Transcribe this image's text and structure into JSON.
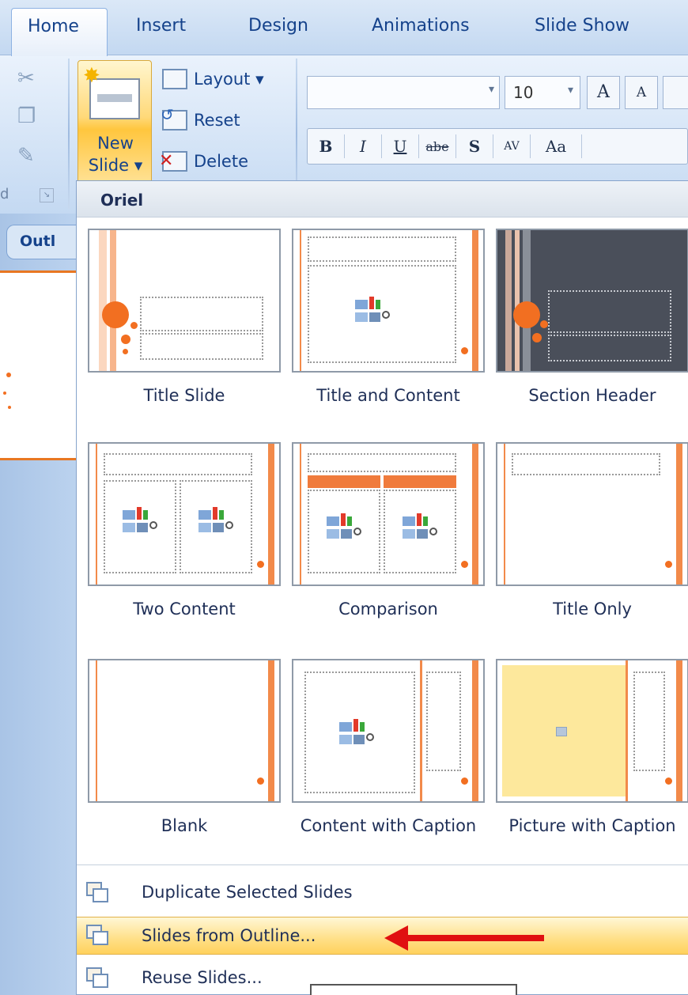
{
  "tabs": [
    "Home",
    "Insert",
    "Design",
    "Animations",
    "Slide Show"
  ],
  "clipboard": {
    "label": "d"
  },
  "slides_group": {
    "new_slide_line1": "New",
    "new_slide_line2": "Slide ▾",
    "layout_label": "Layout ▾",
    "reset_label": "Reset",
    "delete_label": "Delete"
  },
  "font_group": {
    "font_name": "",
    "font_size": "10",
    "grow_label": "A",
    "shrink_label": "A",
    "format_buttons": [
      "B",
      "I",
      "U",
      "abe",
      "S",
      "AV",
      "Aa"
    ]
  },
  "left_pane": {
    "outline_tab": "Outl"
  },
  "gallery": {
    "theme_name": "Oriel",
    "layouts": [
      {
        "name": "Title Slide"
      },
      {
        "name": "Title and Content"
      },
      {
        "name": "Section Header"
      },
      {
        "name": "Two Content"
      },
      {
        "name": "Comparison"
      },
      {
        "name": "Title Only"
      },
      {
        "name": "Blank"
      },
      {
        "name": "Content with Caption"
      },
      {
        "name": "Picture with Caption"
      }
    ]
  },
  "commands": [
    {
      "label": "Duplicate Selected Slides",
      "icon": "duplicate-slides-icon"
    },
    {
      "label": "Slides from Outline...",
      "icon": "outline-slides-icon",
      "highlighted": true
    },
    {
      "label": "Reuse Slides...",
      "icon": "reuse-slides-icon"
    }
  ],
  "annotation": {
    "arrow_color": "#e01010"
  }
}
